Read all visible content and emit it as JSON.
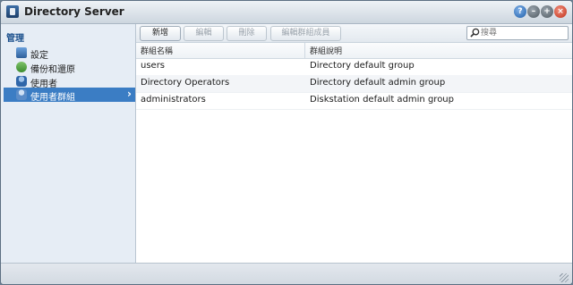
{
  "window": {
    "title": "Directory Server"
  },
  "titlebar_buttons": [
    {
      "icon": "help-icon",
      "glyph": "?"
    },
    {
      "icon": "minimize-icon",
      "glyph": "–"
    },
    {
      "icon": "maximize-icon",
      "glyph": "+"
    },
    {
      "icon": "close-icon",
      "glyph": "×"
    }
  ],
  "sidebar": {
    "header": "管理",
    "items": [
      {
        "label": "設定",
        "icon": "settings-icon"
      },
      {
        "label": "備份和還原",
        "icon": "backup-icon"
      },
      {
        "label": "使用者",
        "icon": "user-icon"
      },
      {
        "label": "使用者群組",
        "icon": "group-icon",
        "active": true
      }
    ]
  },
  "toolbar": {
    "new_label": "新增",
    "edit_label": "編輯",
    "delete_label": "刪除",
    "edit_members_label": "編輯群組成員",
    "search_placeholder": "搜尋"
  },
  "table": {
    "columns": [
      "群組名稱",
      "群組說明"
    ],
    "rows": [
      {
        "name": "users",
        "description": "Directory default group"
      },
      {
        "name": "Directory Operators",
        "description": "Directory default admin group"
      },
      {
        "name": "administrators",
        "description": "Diskstation default admin group"
      }
    ]
  },
  "colors": {
    "accent": "#3b7dc4",
    "sidebar_bg": "#e6edf5"
  }
}
